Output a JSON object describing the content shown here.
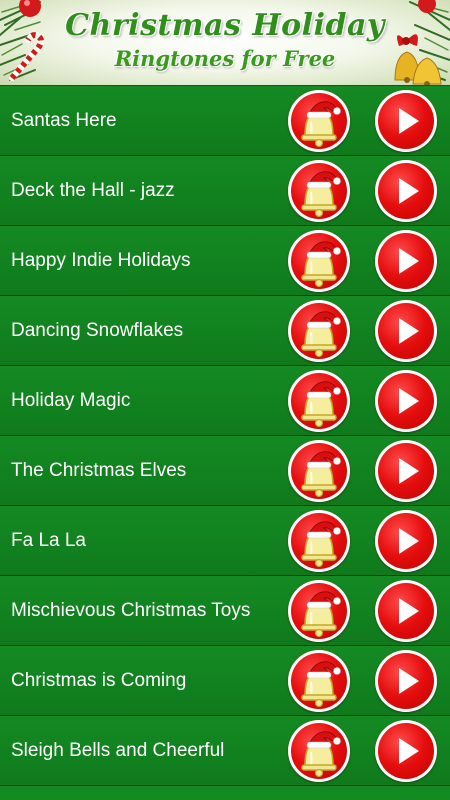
{
  "header": {
    "title_line1": "Christmas Holiday",
    "title_line2": "Ringtones for Free"
  },
  "ringtones": [
    {
      "title": "Santas Here"
    },
    {
      "title": "Deck the Hall - jazz"
    },
    {
      "title": "Happy Indie Holidays"
    },
    {
      "title": "Dancing Snowflakes"
    },
    {
      "title": "Holiday Magic"
    },
    {
      "title": "The Christmas Elves"
    },
    {
      "title": "Fa La La"
    },
    {
      "title": "Mischievous Christmas Toys"
    },
    {
      "title": "Christmas is Coming"
    },
    {
      "title": "Sleigh Bells and Cheerful"
    }
  ],
  "icons": {
    "set_ringtone": "bell-santa-hat-icon",
    "play": "play-icon"
  },
  "colors": {
    "row_green": "#148a23",
    "button_red": "#e50e0e",
    "title_green": "#2f8f1a"
  }
}
